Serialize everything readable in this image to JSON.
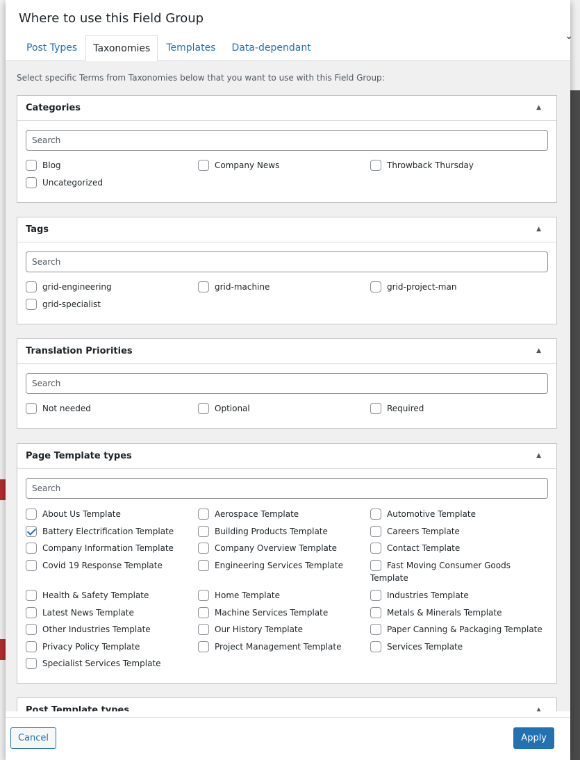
{
  "modal": {
    "title": "Where to use this Field Group",
    "intro": "Select specific Terms from Taxonomies below that you want to use with this Field Group:"
  },
  "tabs": [
    {
      "label": "Post Types",
      "active": false
    },
    {
      "label": "Taxonomies",
      "active": true
    },
    {
      "label": "Templates",
      "active": false
    },
    {
      "label": "Data-dependant",
      "active": false
    }
  ],
  "search_placeholder": "Search",
  "sections": {
    "categories": {
      "title": "Categories",
      "options": [
        {
          "label": "Blog",
          "checked": false
        },
        {
          "label": "Company News",
          "checked": false
        },
        {
          "label": "Throwback Thursday",
          "checked": false
        },
        {
          "label": "Uncategorized",
          "checked": false
        }
      ]
    },
    "tags": {
      "title": "Tags",
      "options": [
        {
          "label": "grid-engineering",
          "checked": false
        },
        {
          "label": "grid-machine",
          "checked": false
        },
        {
          "label": "grid-project-man",
          "checked": false
        },
        {
          "label": "grid-specialist",
          "checked": false
        }
      ]
    },
    "translation": {
      "title": "Translation Priorities",
      "options": [
        {
          "label": "Not needed",
          "checked": false
        },
        {
          "label": "Optional",
          "checked": false
        },
        {
          "label": "Required",
          "checked": false
        }
      ]
    },
    "page_templates": {
      "title": "Page Template types",
      "options": [
        {
          "label": "About Us Template",
          "checked": false
        },
        {
          "label": "Aerospace Template",
          "checked": false
        },
        {
          "label": "Automotive Template",
          "checked": false
        },
        {
          "label": "Battery Electrification Template",
          "checked": true
        },
        {
          "label": "Building Products Template",
          "checked": false
        },
        {
          "label": "Careers Template",
          "checked": false
        },
        {
          "label": "Company Information Template",
          "checked": false
        },
        {
          "label": "Company Overview Template",
          "checked": false
        },
        {
          "label": "Contact Template",
          "checked": false
        },
        {
          "label": "Covid 19 Response Template",
          "checked": false
        },
        {
          "label": "Engineering Services Template",
          "checked": false
        },
        {
          "label": "Fast Moving Consumer Goods Template",
          "checked": false
        },
        {
          "label": "Health & Safety Template",
          "checked": false
        },
        {
          "label": "Home Template",
          "checked": false
        },
        {
          "label": "Industries Template",
          "checked": false
        },
        {
          "label": "Latest News Template",
          "checked": false
        },
        {
          "label": "Machine Services Template",
          "checked": false
        },
        {
          "label": "Metals & Minerals Template",
          "checked": false
        },
        {
          "label": "Other Industries Template",
          "checked": false
        },
        {
          "label": "Our History Template",
          "checked": false
        },
        {
          "label": "Paper Canning & Packaging Template",
          "checked": false
        },
        {
          "label": "Privacy Policy Template",
          "checked": false
        },
        {
          "label": "Project Management Template",
          "checked": false
        },
        {
          "label": "Services Template",
          "checked": false
        },
        {
          "label": "Specialist Services Template",
          "checked": false
        }
      ]
    },
    "post_templates": {
      "title": "Post Template types"
    }
  },
  "footer": {
    "cancel_label": "Cancel",
    "apply_label": "Apply"
  },
  "colors": {
    "accent": "#2271b1",
    "panel_bg": "#f0f0f1",
    "border": "#c3c4c7"
  }
}
